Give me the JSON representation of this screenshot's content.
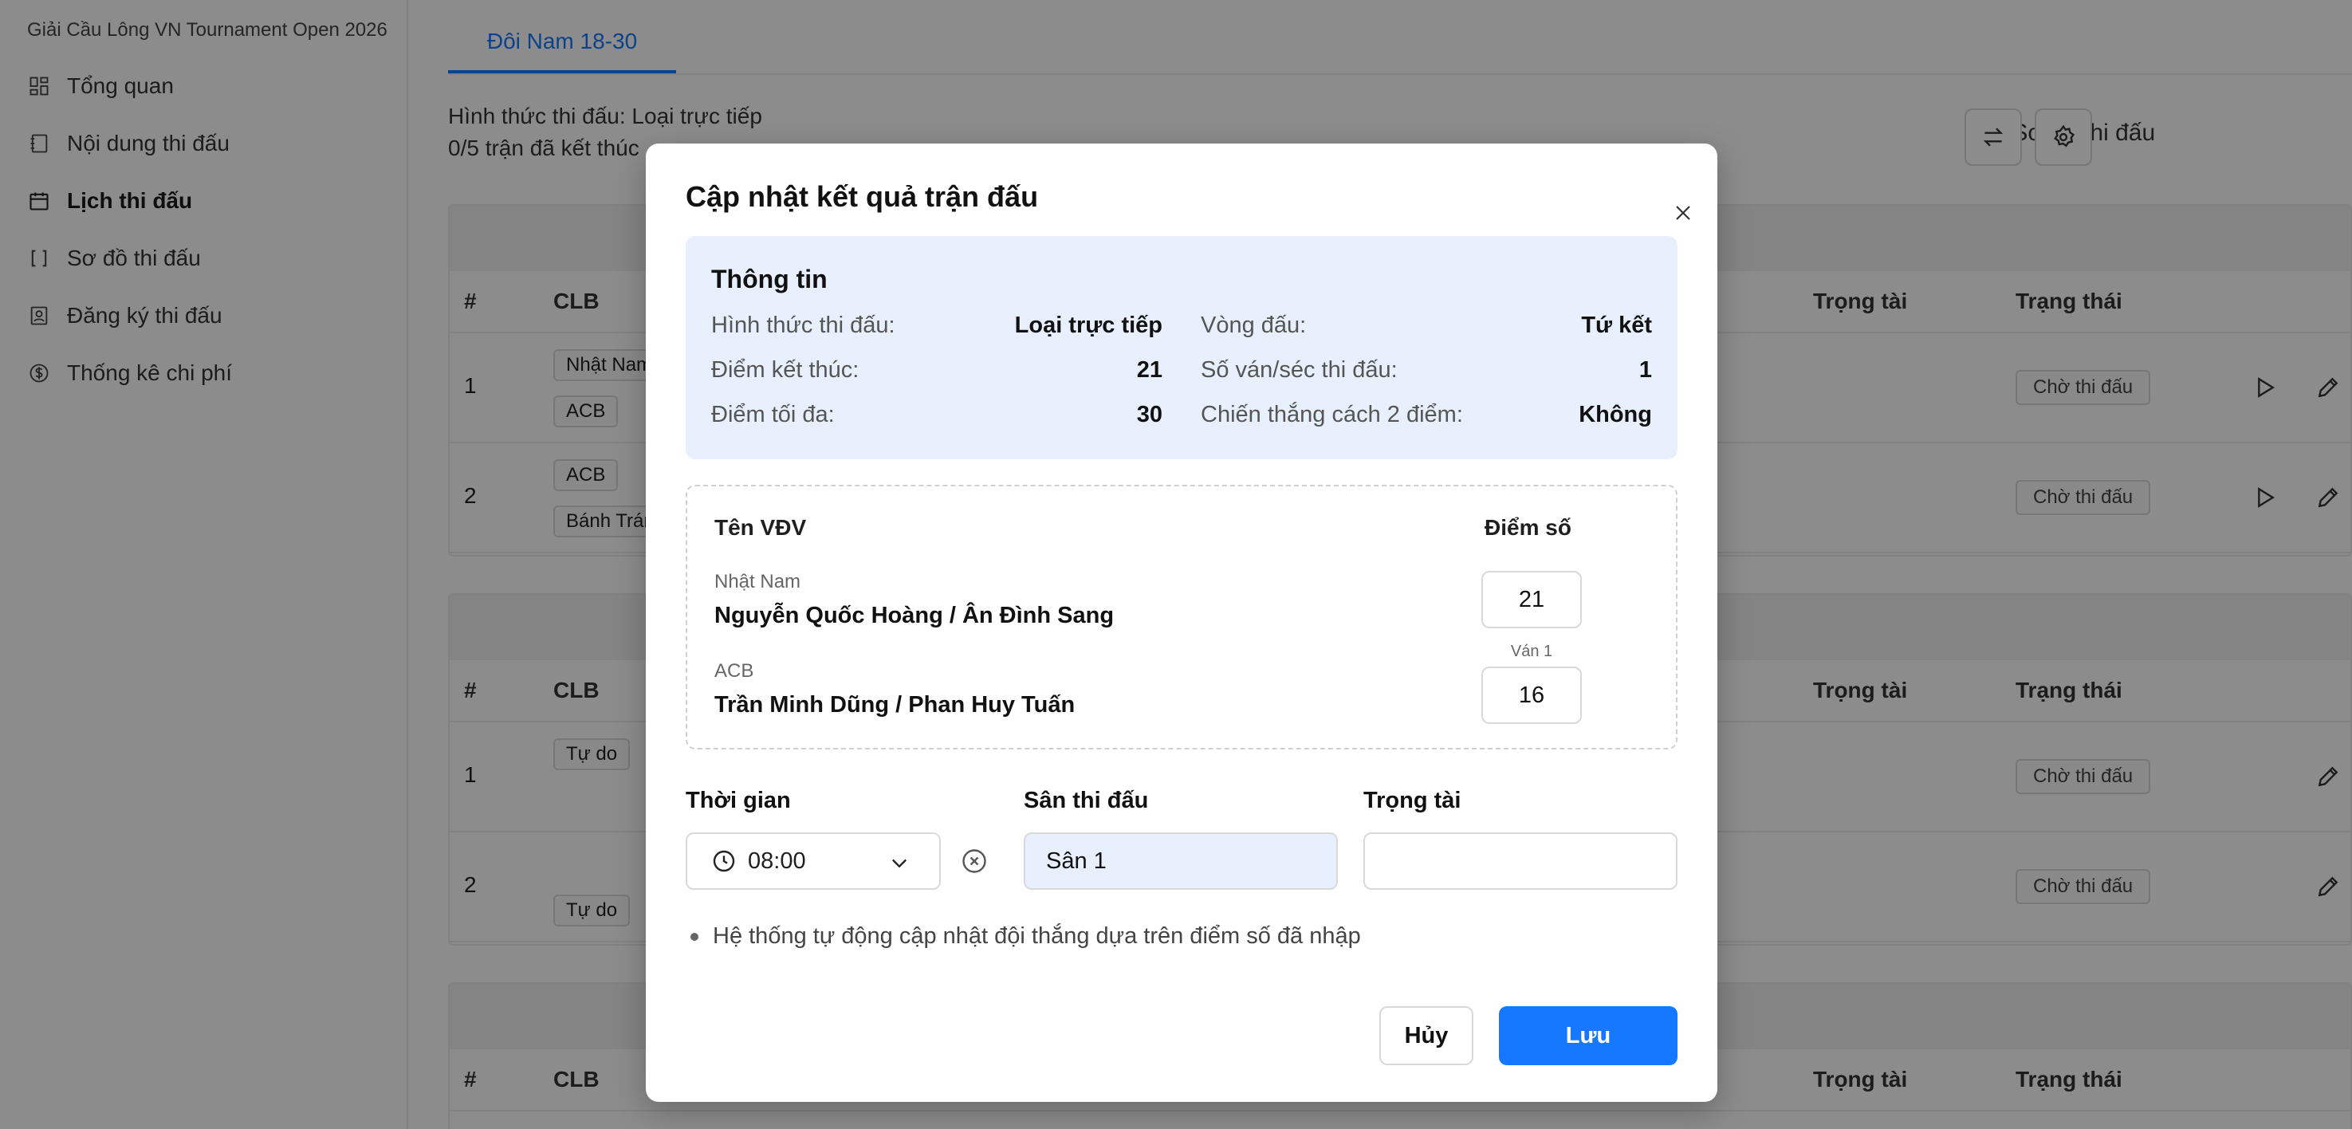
{
  "app": {
    "title": "Giải Cầu Lông VN Tournament Open 2026"
  },
  "sidebar": {
    "items": [
      {
        "label": "Tổng quan",
        "icon": "dashboard-icon"
      },
      {
        "label": "Nội dung thi đấu",
        "icon": "notebook-icon"
      },
      {
        "label": "Lịch thi đấu",
        "icon": "calendar-icon",
        "active": true
      },
      {
        "label": "Sơ đồ thi đấu",
        "icon": "bracket-icon"
      },
      {
        "label": "Đăng ký thi đấu",
        "icon": "user-card-icon"
      },
      {
        "label": "Thống kê chi phí",
        "icon": "dollar-icon"
      }
    ]
  },
  "main": {
    "tab": "Đôi Nam 18-30",
    "format_text": "Hình thức thi đấu: Loại trực tiếp",
    "progress_text": "0/5 trận đã kết thúc",
    "bracket_link": "[ ]  Sơ đồ thi đấu",
    "table_headers": {
      "num": "#",
      "club": "CLB",
      "referee": "Trọng tài",
      "status": "Trạng thái"
    },
    "groups": [
      {
        "rows": [
          {
            "num": "1",
            "clubs": [
              "Nhật Nam",
              "ACB"
            ],
            "status": "Chờ thi đấu"
          },
          {
            "num": "2",
            "clubs": [
              "ACB",
              "Bánh Tráng"
            ],
            "status": "Chờ thi đấu"
          }
        ]
      },
      {
        "rows": [
          {
            "num": "1",
            "clubs": [
              "Tự do"
            ],
            "status": "Chờ thi đấu"
          },
          {
            "num": "2",
            "clubs": [
              "Tự do"
            ],
            "status": "Chờ thi đấu"
          }
        ]
      }
    ]
  },
  "modal": {
    "title": "Cập nhật kết quả trận đấu",
    "info": {
      "title": "Thông tin",
      "format_label": "Hình thức thi đấu:",
      "format_value": "Loại trực tiếp",
      "round_label": "Vòng đấu:",
      "round_value": "Tứ kết",
      "end_point_label": "Điểm kết thúc:",
      "end_point_value": "21",
      "sets_label": "Số ván/séc thi đấu:",
      "sets_value": "1",
      "max_point_label": "Điểm tối đa:",
      "max_point_value": "30",
      "win_by_two_label": "Chiến thắng cách 2 điểm:",
      "win_by_two_value": "Không"
    },
    "scores": {
      "col_name": "Tên VĐV",
      "col_score": "Điểm số",
      "set_label": "Ván 1",
      "team1_club": "Nhật Nam",
      "team1_players": "Nguyễn Quốc Hoàng / Ân Đình Sang",
      "team1_score": "21",
      "team2_club": "ACB",
      "team2_players": "Trần Minh Dũng / Phan Huy Tuấn",
      "team2_score": "16"
    },
    "fields": {
      "time_label": "Thời gian",
      "time_value": "08:00",
      "court_label": "Sân thi đấu",
      "court_value": "Sân 1",
      "referee_label": "Trọng tài",
      "referee_value": ""
    },
    "note": "Hệ thống tự động cập nhật đội thắng dựa trên điểm số đã nhập",
    "cancel_label": "Hủy",
    "save_label": "Lưu"
  },
  "colors": {
    "accent": "#1677ff",
    "info_bg": "#e8f0fe"
  }
}
